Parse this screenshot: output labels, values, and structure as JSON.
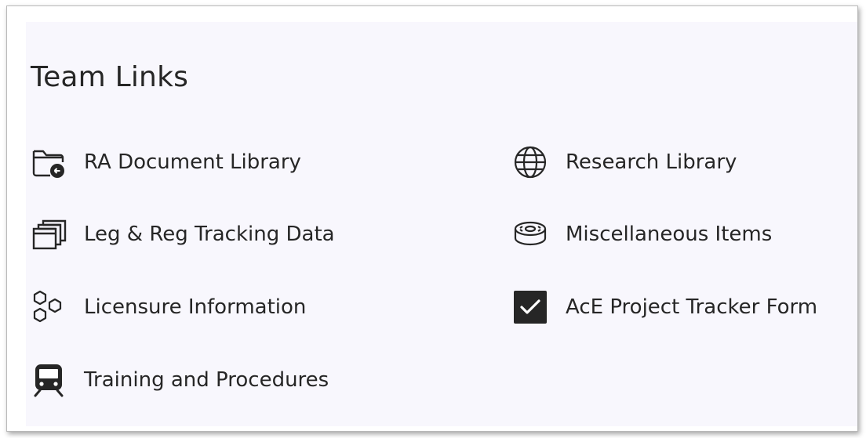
{
  "section": {
    "title": "Team Links"
  },
  "links": {
    "ra_document_library": {
      "label": "RA Document Library",
      "icon": "folder-shared-icon"
    },
    "leg_reg_tracking": {
      "label": "Leg & Reg Tracking Data",
      "icon": "stacked-windows-icon"
    },
    "licensure_information": {
      "label": "Licensure Information",
      "icon": "hexagons-icon"
    },
    "training_procedures": {
      "label": "Training and Procedures",
      "icon": "train-icon"
    },
    "research_library": {
      "label": "Research Library",
      "icon": "globe-icon"
    },
    "miscellaneous_items": {
      "label": "Miscellaneous Items",
      "icon": "disk-icon"
    },
    "ace_project_tracker": {
      "label": "AcE Project Tracker Form",
      "icon": "checkbox-checked-icon"
    }
  }
}
